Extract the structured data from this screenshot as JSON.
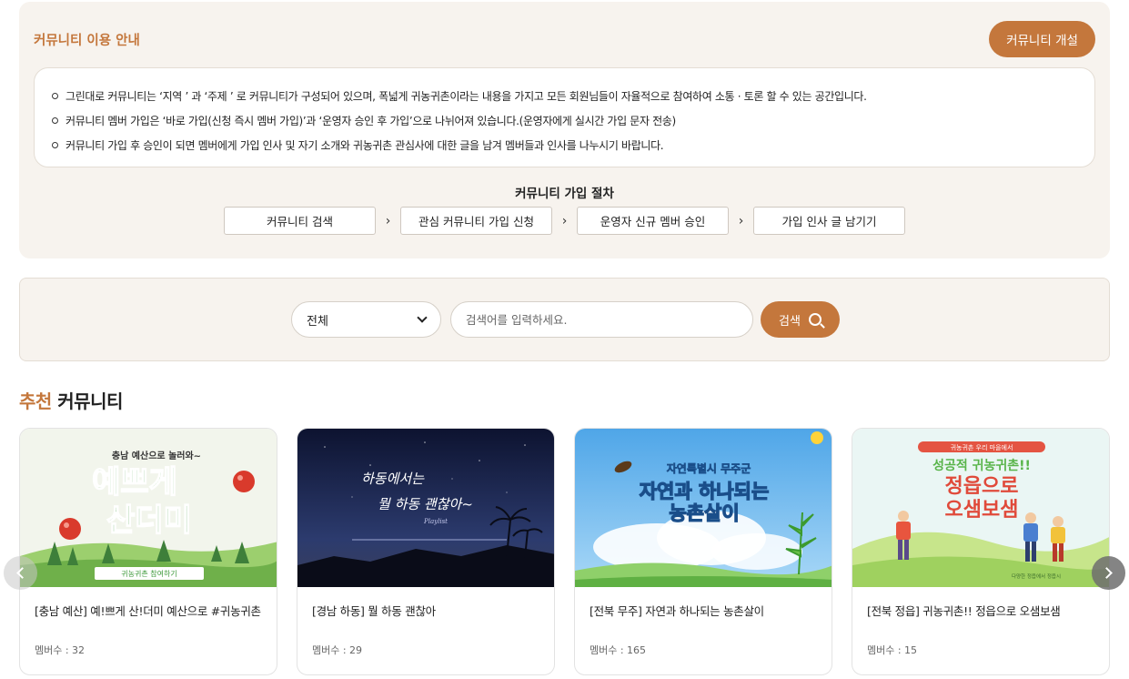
{
  "guide": {
    "title": "커뮤니티 이용 안내",
    "open_button": "커뮤니티 개설",
    "notices": [
      "그린대로 커뮤니티는 ‘지역 ’ 과 ‘주제 ’ 로 커뮤니티가 구성되어 있으며, 폭넓게 귀농귀촌이라는 내용을 가지고 모든 회원님들이 자율적으로 참여하여 소통 · 토론 할 수 있는 공간입니다.",
      "커뮤니티 멤버 가입은 ‘바로 가입(신청 즉시 멤버 가입)’과 ‘운영자 승인 후 가입’으로 나뉘어져 있습니다.(운영자에게 실시간 가입 문자 전송)",
      "커뮤니티 가입 후 승인이 되면 멤버에게 가입 인사 및 자기 소개와 귀농귀촌 관심사에 대한 글을 남겨 멤버들과 인사를 나누시기 바랍니다."
    ],
    "steps_title": "커뮤니티 가입 절차",
    "steps": [
      "커뮤니티 검색",
      "관심 커뮤니티 가입 신청",
      "운영자 신규 멤버 승인",
      "가입 인사 글 남기기"
    ]
  },
  "search": {
    "select_value": "전체",
    "placeholder": "검색어를 입력하세요.",
    "button_label": "검색"
  },
  "recommended": {
    "title_accent": "추천",
    "title_rest": " 커뮤니티",
    "cards": [
      {
        "title": "[충남 예산] 예!쁘게 산!더미 예산으로 #귀농귀촌",
        "members": "멤버수 : 32",
        "img_sub": "충남 예산으로 놀러와~",
        "img_main1": "예쁘게",
        "img_main2": "산더미",
        "img_banner": "귀농귀촌 참여하기"
      },
      {
        "title": "[경남 하동] 뭘 하동 괜찮아",
        "members": "멤버수 : 29",
        "img_line1": "하동에서는",
        "img_line2": "뭘 하동 괜찮아~",
        "img_small": "Playlist"
      },
      {
        "title": "[전북 무주] 자연과 하나되는 농촌살이",
        "members": "멤버수 : 165",
        "img_sub": "자연특별시 무주군",
        "img_main1": "자연과 하나되는",
        "img_main2": "농촌살이"
      },
      {
        "title": "[전북 정읍] 귀농귀촌!! 정읍으로 오샘보샘",
        "members": "멤버수 : 15",
        "img_tag": "귀농귀촌 우리 마을에서",
        "img_sub": "성공적 귀농귀촌!!",
        "img_main1": "정읍으로",
        "img_main2": "오샘보샘",
        "img_foot": "다양한 정읍에서 정읍시"
      }
    ]
  },
  "colors": {
    "accent": "#c4773c",
    "panel_bg": "#f7f3ee"
  }
}
